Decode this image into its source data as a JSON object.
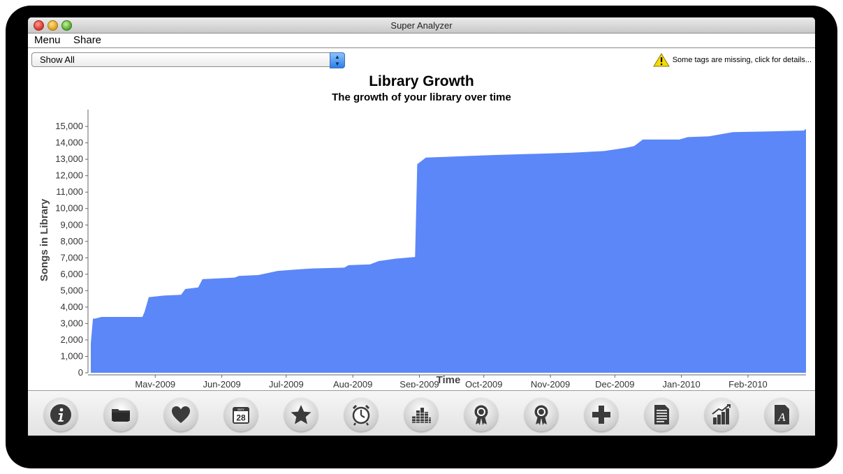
{
  "window": {
    "title": "Super Analyzer"
  },
  "menu": {
    "items": [
      "Menu",
      "Share"
    ]
  },
  "filter": {
    "selected": "Show All"
  },
  "notice": {
    "text": "Some tags are missing, click for details..."
  },
  "chart_data": {
    "type": "area",
    "title": "Library Growth",
    "subtitle": "The growth of your library over time",
    "xlabel": "Time",
    "ylabel": "Songs in Library",
    "ylim": [
      0,
      15600
    ],
    "yticks": [
      0,
      1000,
      2000,
      3000,
      4000,
      5000,
      6000,
      7000,
      8000,
      9000,
      10000,
      11000,
      12000,
      13000,
      14000,
      15000
    ],
    "ytick_labels": [
      "0",
      "1,000",
      "2,000",
      "3,000",
      "4,000",
      "5,000",
      "6,000",
      "7,000",
      "8,000",
      "9,000",
      "10,000",
      "11,000",
      "12,000",
      "13,000",
      "14,000",
      "15,000"
    ],
    "xlim": [
      "2009-04-01",
      "2010-02-28"
    ],
    "xticks": [
      "2009-05-01",
      "2009-06-01",
      "2009-07-01",
      "2009-08-01",
      "2009-09-01",
      "2009-10-01",
      "2009-11-01",
      "2009-12-01",
      "2010-01-01",
      "2010-02-01"
    ],
    "xtick_labels": [
      "May-2009",
      "Jun-2009",
      "Jul-2009",
      "Aug-2009",
      "Sep-2009",
      "Oct-2009",
      "Nov-2009",
      "Dec-2009",
      "Jan-2010",
      "Feb-2010"
    ],
    "color": "#5b87f8",
    "grid": false,
    "series": [
      {
        "points": [
          [
            "2009-04-01",
            1800
          ],
          [
            "2009-04-02",
            3300
          ],
          [
            "2009-04-03",
            3300
          ],
          [
            "2009-04-06",
            3400
          ],
          [
            "2009-04-20",
            3400
          ],
          [
            "2009-04-25",
            3400
          ],
          [
            "2009-04-26",
            3700
          ],
          [
            "2009-04-28",
            4600
          ],
          [
            "2009-05-05",
            4700
          ],
          [
            "2009-05-13",
            4750
          ],
          [
            "2009-05-15",
            5100
          ],
          [
            "2009-05-21",
            5200
          ],
          [
            "2009-05-23",
            5700
          ],
          [
            "2009-06-07",
            5800
          ],
          [
            "2009-06-09",
            5900
          ],
          [
            "2009-06-18",
            5950
          ],
          [
            "2009-06-27",
            6200
          ],
          [
            "2009-07-07",
            6300
          ],
          [
            "2009-07-13",
            6350
          ],
          [
            "2009-07-28",
            6400
          ],
          [
            "2009-07-30",
            6550
          ],
          [
            "2009-08-09",
            6600
          ],
          [
            "2009-08-13",
            6800
          ],
          [
            "2009-08-21",
            6950
          ],
          [
            "2009-08-30",
            7050
          ],
          [
            "2009-08-31",
            12700
          ],
          [
            "2009-09-04",
            13100
          ],
          [
            "2009-09-14",
            13150
          ],
          [
            "2009-09-23",
            13200
          ],
          [
            "2009-10-04",
            13250
          ],
          [
            "2009-10-16",
            13300
          ],
          [
            "2009-10-30",
            13350
          ],
          [
            "2009-11-11",
            13400
          ],
          [
            "2009-11-26",
            13500
          ],
          [
            "2009-12-06",
            13700
          ],
          [
            "2009-12-10",
            13800
          ],
          [
            "2009-12-14",
            14200
          ],
          [
            "2009-12-31",
            14200
          ],
          [
            "2010-01-04",
            14350
          ],
          [
            "2010-01-14",
            14400
          ],
          [
            "2010-01-25",
            14650
          ],
          [
            "2010-02-11",
            14700
          ],
          [
            "2010-02-27",
            14750
          ],
          [
            "2010-02-28",
            14850
          ]
        ]
      }
    ]
  },
  "toolbar": {
    "icons": [
      "info-icon",
      "folder-icon",
      "heart-icon",
      "calendar-icon",
      "star-icon",
      "alarm-clock-icon",
      "equalizer-icon",
      "award-ribbon-icon",
      "award-ribbon-alt-icon",
      "plus-icon",
      "document-icon",
      "growth-chart-icon",
      "font-icon"
    ],
    "calendar_month": "MAY",
    "calendar_day": "28",
    "font_glyph": "A"
  }
}
